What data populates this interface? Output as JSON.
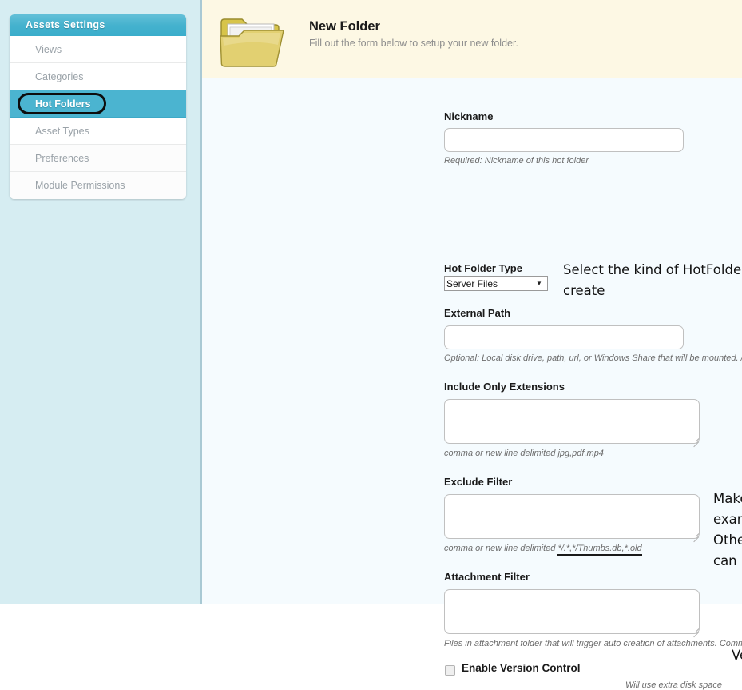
{
  "sidebar": {
    "title": "Assets Settings",
    "items": [
      {
        "label": "Views",
        "active": false
      },
      {
        "label": "Categories",
        "active": false
      },
      {
        "label": "Hot Folders",
        "active": true
      },
      {
        "label": "Asset Types",
        "active": false
      },
      {
        "label": "Preferences",
        "active": false
      },
      {
        "label": "Module Permissions",
        "active": false
      }
    ],
    "highlight_target": "Hot Folders"
  },
  "header": {
    "icon": "open-folder-icon",
    "title": "New Folder",
    "subtitle": "Fill out the form below to setup your new folder."
  },
  "form": {
    "nickname": {
      "label": "Nickname",
      "value": "",
      "placeholder": "",
      "hint": "Required: Nickname of this hot folder"
    },
    "hot_folder_type": {
      "label": "Hot Folder Type",
      "selected": "Server Files",
      "options": [
        "Server Files"
      ]
    },
    "external_path": {
      "label": "External Path",
      "value": "",
      "placeholder": "",
      "hint": "Optional: Local disk drive, path, url, or Windows Share that will be mounted. /media/marketing_drive"
    },
    "include_only_extensions": {
      "label": "Include Only Extensions",
      "value": "",
      "placeholder": "",
      "hint": "comma or new line delimited jpg,pdf,mp4"
    },
    "exclude_filter": {
      "label": "Exclude Filter",
      "value": "",
      "placeholder": "",
      "hint_prefix": "comma or new line delimited ",
      "hint_underlined": "*/.*,*/Thumbs.db,*.old"
    },
    "attachment_filter": {
      "label": "Attachment Filter",
      "value": "",
      "placeholder": "",
      "hint": "Files in attachment folder that will trigger auto creation of attachments. Comma or New line delimited */Fonts */attachments.txt"
    },
    "enable_version_control": {
      "label": "Enable Version Control",
      "checked": false,
      "hint": "Will use extra disk space"
    }
  },
  "annotations": {
    "hot_folder_type_note": "Select the kind of HotFolder that you would like to create",
    "exclude_filter_note": "Make sure to exclude the examples below at minimum. Other subfolders, file extensions can be excluded as well.",
    "version_control_note": "Version control is available."
  },
  "colors": {
    "accent": "#4bb4d0",
    "panel_background": "#d6edf2",
    "header_band": "#fdf8e4",
    "content_background": "#f5fbfe",
    "annotation": "#121212"
  }
}
